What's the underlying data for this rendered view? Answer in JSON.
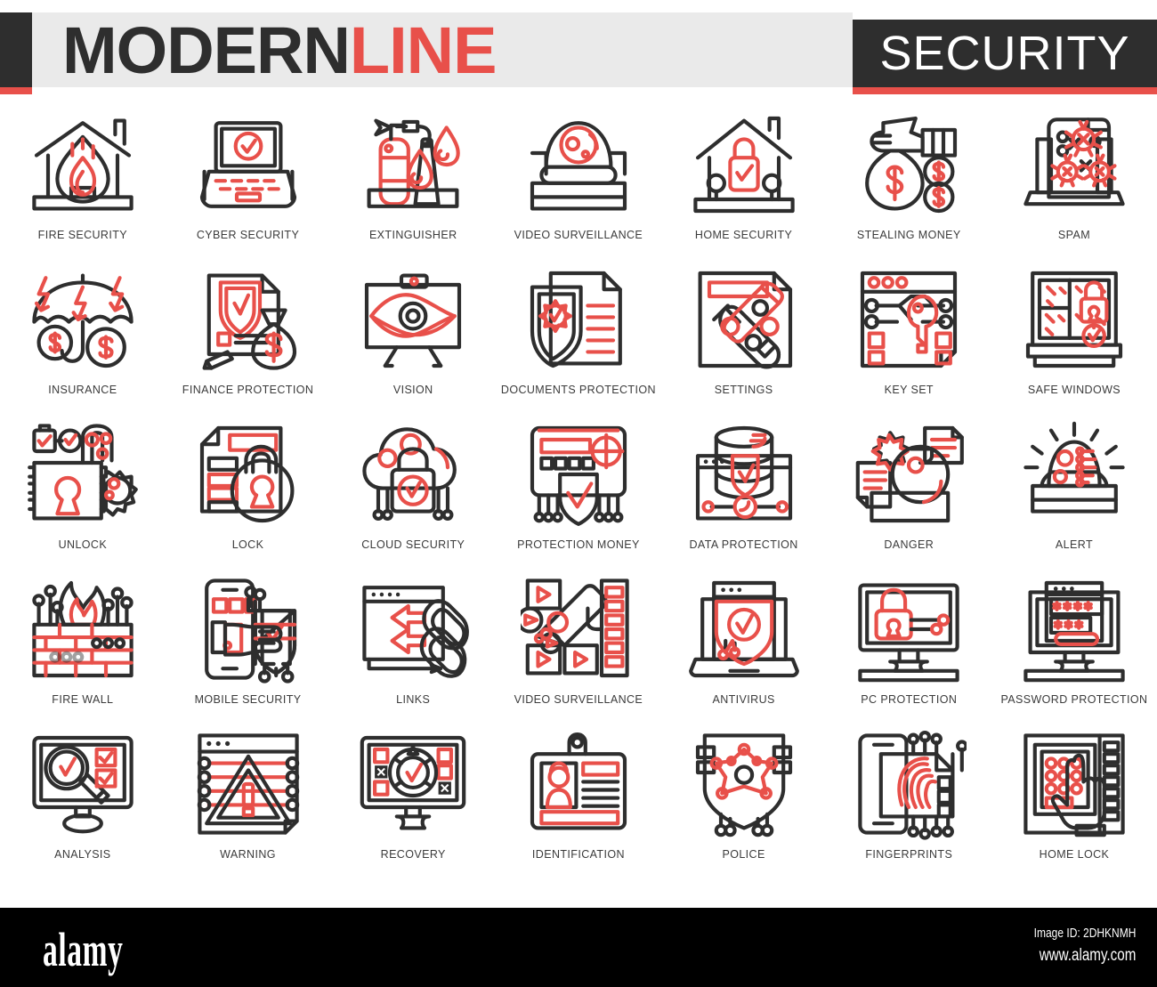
{
  "header": {
    "brand_part1": "MODERN",
    "brand_part2": "LINE",
    "category": "SECURITY",
    "colors": {
      "dark": "#2e2e2e",
      "red": "#e8504a",
      "gray_band": "#eaeaea"
    }
  },
  "icons": [
    {
      "id": "fire-security",
      "label": "FIRE SECURITY"
    },
    {
      "id": "cyber-security",
      "label": "CYBER SECURITY"
    },
    {
      "id": "extinguisher",
      "label": "EXTINGUISHER"
    },
    {
      "id": "video-surveillance-1",
      "label": "VIDEO SURVEILLANCE"
    },
    {
      "id": "home-security",
      "label": "HOME SECURITY"
    },
    {
      "id": "stealing-money",
      "label": "STEALING MONEY"
    },
    {
      "id": "spam",
      "label": "SPAM"
    },
    {
      "id": "insurance",
      "label": "INSURANCE"
    },
    {
      "id": "finance-protection",
      "label": "FINANCE PROTECTION"
    },
    {
      "id": "vision",
      "label": "VISION"
    },
    {
      "id": "documents-protection",
      "label": "DOCUMENTS PROTECTION"
    },
    {
      "id": "settings",
      "label": "SETTINGS"
    },
    {
      "id": "key-set",
      "label": "KEY SET"
    },
    {
      "id": "safe-windows",
      "label": "SAFE WINDOWS"
    },
    {
      "id": "unlock",
      "label": "UNLOCK"
    },
    {
      "id": "lock",
      "label": "LOCK"
    },
    {
      "id": "cloud-security",
      "label": "CLOUD SECURITY"
    },
    {
      "id": "protection-money",
      "label": "PROTECTION MONEY"
    },
    {
      "id": "data-protection",
      "label": "DATA PROTECTION"
    },
    {
      "id": "danger",
      "label": "DANGER"
    },
    {
      "id": "alert",
      "label": "ALERT"
    },
    {
      "id": "fire-wall",
      "label": "FIRE WALL"
    },
    {
      "id": "mobile-security",
      "label": "MOBILE SECURITY"
    },
    {
      "id": "links",
      "label": "LINKS"
    },
    {
      "id": "video-surveillance-2",
      "label": "VIDEO SURVEILLANCE"
    },
    {
      "id": "antivirus",
      "label": "ANTIVIRUS"
    },
    {
      "id": "pc-protection",
      "label": "PC PROTECTION"
    },
    {
      "id": "password-protection",
      "label": "PASSWORD PROTECTION"
    },
    {
      "id": "analysis",
      "label": "ANALYSIS"
    },
    {
      "id": "warning",
      "label": "WARNING"
    },
    {
      "id": "recovery",
      "label": "RECOVERY"
    },
    {
      "id": "identification",
      "label": "IDENTIFICATION"
    },
    {
      "id": "police",
      "label": "POLICE"
    },
    {
      "id": "fingerprints",
      "label": "FINGERPRINTS"
    },
    {
      "id": "home-lock",
      "label": "HOME LOCK"
    }
  ],
  "footer": {
    "logo": "alamy",
    "image_id": "Image ID: 2DHKNMH",
    "url": "www.alamy.com"
  }
}
